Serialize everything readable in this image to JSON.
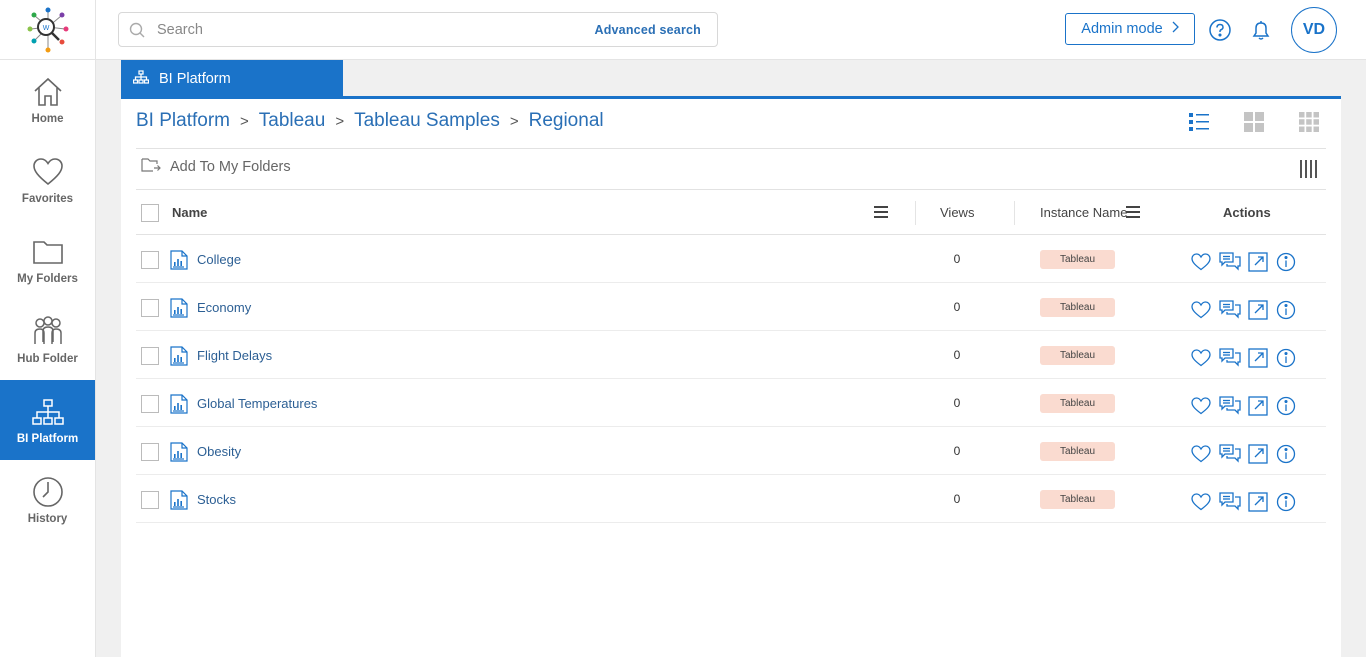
{
  "nav": {
    "items": [
      {
        "label": "Home",
        "icon": "home-icon"
      },
      {
        "label": "Favorites",
        "icon": "heart-icon"
      },
      {
        "label": "My Folders",
        "icon": "folder-icon"
      },
      {
        "label": "Hub Folder",
        "icon": "people-icon"
      },
      {
        "label": "BI Platform",
        "icon": "hierarchy-icon",
        "active": true
      },
      {
        "label": "History",
        "icon": "clock-icon"
      }
    ]
  },
  "header": {
    "search_placeholder": "Search",
    "advanced_search": "Advanced search",
    "admin_mode": "Admin mode",
    "avatar_initials": "VD"
  },
  "tab": {
    "label": "BI Platform"
  },
  "breadcrumb": [
    "BI Platform",
    "Tableau",
    "Tableau Samples",
    "Regional"
  ],
  "toolbar": {
    "add_to_folders": "Add To My Folders"
  },
  "table": {
    "columns": {
      "name": "Name",
      "views": "Views",
      "instance": "Instance Name",
      "actions": "Actions"
    },
    "rows": [
      {
        "name": "College",
        "views": "0",
        "instance": "Tableau"
      },
      {
        "name": "Economy",
        "views": "0",
        "instance": "Tableau"
      },
      {
        "name": "Flight Delays",
        "views": "0",
        "instance": "Tableau"
      },
      {
        "name": "Global Temperatures",
        "views": "0",
        "instance": "Tableau"
      },
      {
        "name": "Obesity",
        "views": "0",
        "instance": "Tableau"
      },
      {
        "name": "Stocks",
        "views": "0",
        "instance": "Tableau"
      }
    ]
  },
  "colors": {
    "accent": "#1a73c9",
    "link": "#2c5f94",
    "badge_bg": "#fadbd0"
  }
}
